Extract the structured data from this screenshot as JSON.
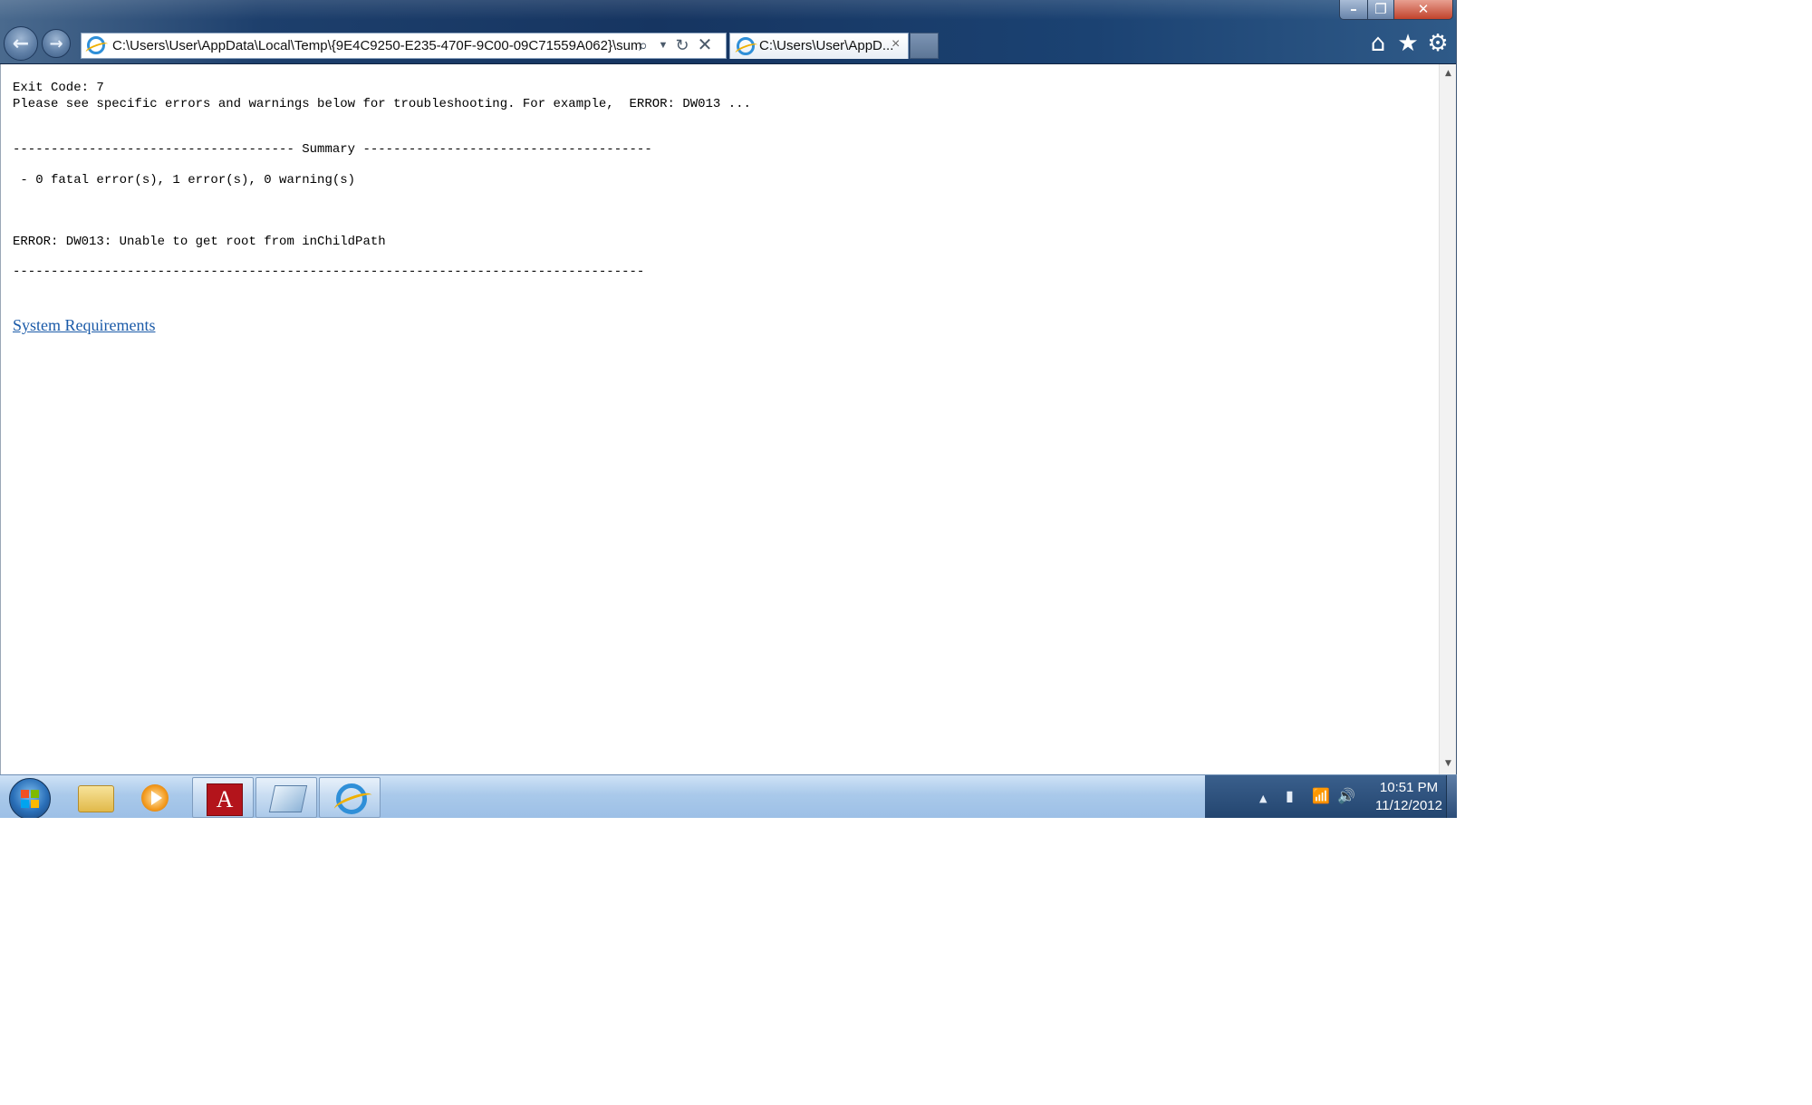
{
  "browser": {
    "address_url": "C:\\Users\\User\\AppData\\Local\\Temp\\{9E4C9250-E235-470F-9C00-09C71559A062}\\sum",
    "tab_title": "C:\\Users\\User\\AppD...",
    "tab_close": "×",
    "nav": {
      "back": "←",
      "forward": "→"
    },
    "icons": {
      "search": "⌕",
      "dropdown": "▼",
      "refresh": "↻",
      "stop": "✕",
      "home": "⌂",
      "favorites": "★",
      "tools": "⚙"
    },
    "window_controls": {
      "minimize": "–",
      "maximize": "❐",
      "close": "✕"
    }
  },
  "page": {
    "exit_code": "Exit Code: 7",
    "see_errors": "Please see specific errors and warnings below for troubleshooting. For example,  ERROR: DW013 ...",
    "summary_header": "------------------------------------- Summary --------------------------------------",
    "counts": " - 0 fatal error(s), 1 error(s), 0 warning(s)",
    "error": "ERROR: DW013: Unable to get root from inChildPath",
    "divider": "-----------------------------------------------------------------------------------",
    "link_label": "System Requirements"
  },
  "scrollbar": {
    "up": "▲",
    "down": "▼"
  },
  "taskbar": {
    "acrobat_glyph": "A",
    "tray": {
      "arrow": "▲",
      "battery": "▮",
      "network": "📶",
      "volume": "🔊"
    },
    "clock_time": "10:51 PM",
    "clock_date": "11/12/2012"
  },
  "colors": {
    "link": "#1a5aa8",
    "titlebar": "#163561",
    "taskbar": "#a9c9ea"
  }
}
